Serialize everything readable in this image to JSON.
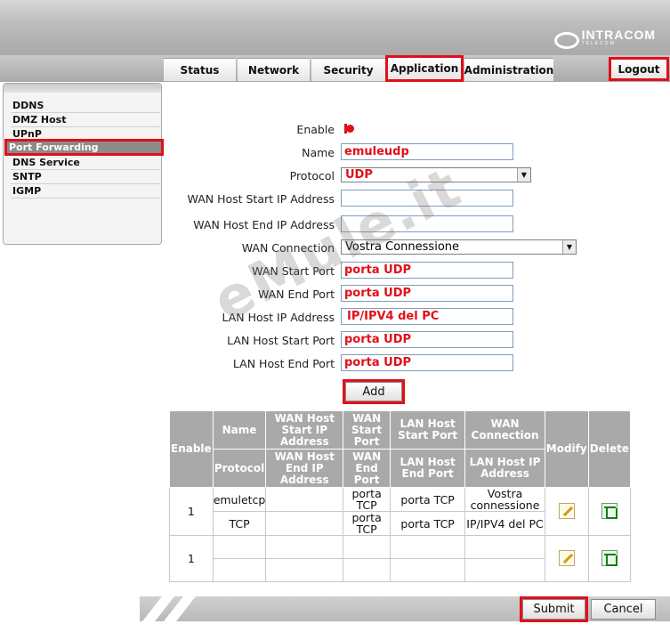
{
  "header": {
    "logo_brand": "INTRACOM",
    "logo_sub": "TELECOM"
  },
  "tabs": [
    {
      "label": "Status"
    },
    {
      "label": "Network"
    },
    {
      "label": "Security"
    },
    {
      "label": "Application"
    },
    {
      "label": "Administration"
    }
  ],
  "logout_label": "Logout",
  "sidebar": {
    "items": [
      {
        "label": "DDNS"
      },
      {
        "label": "DMZ Host"
      },
      {
        "label": "UPnP"
      },
      {
        "label": "Port Forwarding"
      },
      {
        "label": "DNS Service"
      },
      {
        "label": "SNTP"
      },
      {
        "label": "IGMP"
      }
    ]
  },
  "form": {
    "enable_label": "Enable",
    "name_label": "Name",
    "name_value": "emuleudp",
    "protocol_label": "Protocol",
    "protocol_value": "UDP",
    "wan_host_start_label": "WAN Host Start IP Address",
    "wan_host_start_value": "",
    "wan_host_end_label": "WAN Host End IP Address",
    "wan_host_end_value": "",
    "wan_connection_label": "WAN Connection",
    "wan_connection_value": "Vostra Connessione",
    "wan_start_port_label": "WAN Start Port",
    "wan_start_port_value": "porta UDP",
    "wan_end_port_label": "WAN End Port",
    "wan_end_port_value": "porta UDP",
    "lan_host_ip_label": "LAN Host IP Address",
    "lan_host_ip_value": "IP/IPV4 del PC",
    "lan_host_start_port_label": "LAN Host Start Port",
    "lan_host_start_port_value": "porta UDP",
    "lan_host_end_port_label": "LAN Host End Port",
    "lan_host_end_port_value": "porta UDP",
    "add_label": "Add"
  },
  "watermark": "eMule.it",
  "table": {
    "headers": {
      "enable": "Enable",
      "name": "Name",
      "protocol": "Protocol",
      "wan_host_start": "WAN Host Start IP Address",
      "wan_host_end": "WAN Host End IP Address",
      "wan_start_port": "WAN Start Port",
      "wan_end_port": "WAN End Port",
      "lan_host_start_port": "LAN Host Start Port",
      "lan_host_end_port": "LAN Host End Port",
      "wan_connection": "WAN Connection",
      "lan_host_ip": "LAN Host IP Address",
      "modify": "Modify",
      "delete": "Delete"
    },
    "rows": [
      {
        "enable": "1",
        "name": "emuletcp",
        "protocol": "TCP",
        "wan_host_start": "",
        "wan_host_end": "",
        "wan_start_port": "porta TCP",
        "wan_end_port": "porta TCP",
        "lan_host_start_port": "porta TCP",
        "lan_host_end_port": "porta TCP",
        "wan_connection": "Vostra connessione",
        "lan_host_ip": "IP/IPV4 del PC"
      },
      {
        "enable": "1",
        "name": "",
        "protocol": "",
        "wan_host_start": "",
        "wan_host_end": "",
        "wan_start_port": "",
        "wan_end_port": "",
        "lan_host_start_port": "",
        "lan_host_end_port": "",
        "wan_connection": "",
        "lan_host_ip": ""
      }
    ]
  },
  "footer": {
    "submit_label": "Submit",
    "cancel_label": "Cancel"
  },
  "colors": {
    "highlight": "#e0101a",
    "header_gray": "#a9a9a9"
  }
}
